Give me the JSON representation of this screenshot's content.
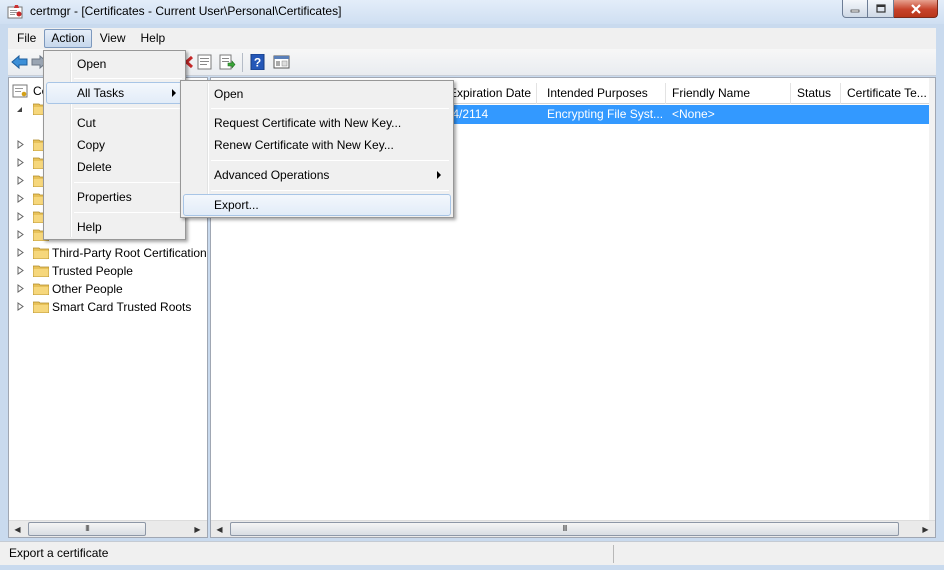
{
  "window": {
    "title": "certmgr - [Certificates - Current User\\Personal\\Certificates]",
    "app_icon": "certificate-manager-icon",
    "buttons": [
      "minimize-icon",
      "maximize-icon",
      "close-icon"
    ]
  },
  "menubar": {
    "items": [
      {
        "label": "File"
      },
      {
        "label": "Action",
        "active": true
      },
      {
        "label": "View"
      },
      {
        "label": "Help"
      }
    ]
  },
  "toolbar": {
    "icons": [
      "back-arrow-icon",
      "forward-arrow-icon",
      "delete-icon",
      "properties-icon",
      "export-list-icon",
      "help-icon",
      "show-hide-tree-icon"
    ]
  },
  "tree": {
    "root_label": "Ce",
    "visible_items": [
      {
        "label": "Third-Party Root Certification"
      },
      {
        "label": "Trusted People"
      },
      {
        "label": "Other People"
      },
      {
        "label": "Smart Card Trusted Roots"
      }
    ]
  },
  "list": {
    "columns": [
      {
        "label": "Expiration Date"
      },
      {
        "label": "Intended Purposes"
      },
      {
        "label": "Friendly Name"
      },
      {
        "label": "Status"
      },
      {
        "label": "Certificate Te..."
      }
    ],
    "rows": [
      {
        "expiration": "/4/2114",
        "purposes": "Encrypting File Syst...",
        "friendly_name": "<None>",
        "status": "",
        "template": ""
      }
    ]
  },
  "action_menu": {
    "items": [
      {
        "label": "Open"
      },
      {
        "label": "All Tasks",
        "submenu": true,
        "hot": true
      },
      {
        "label": "Cut"
      },
      {
        "label": "Copy"
      },
      {
        "label": "Delete"
      },
      {
        "label": "Properties"
      },
      {
        "label": "Help"
      }
    ]
  },
  "all_tasks_menu": {
    "items": [
      {
        "label": "Open"
      },
      {
        "label": "Request Certificate with New Key..."
      },
      {
        "label": "Renew Certificate with New Key..."
      },
      {
        "label": "Advanced Operations",
        "submenu": true
      },
      {
        "label": "Export...",
        "hot": true
      }
    ]
  },
  "scrollbar": {
    "thumb_grip": "III"
  },
  "status": {
    "text": "Export a certificate"
  },
  "colors": {
    "selection": "#3399ff",
    "menu_bg": "#f0f0f0",
    "titlebar": "#cfdff2",
    "close_button": "#c7432b"
  }
}
